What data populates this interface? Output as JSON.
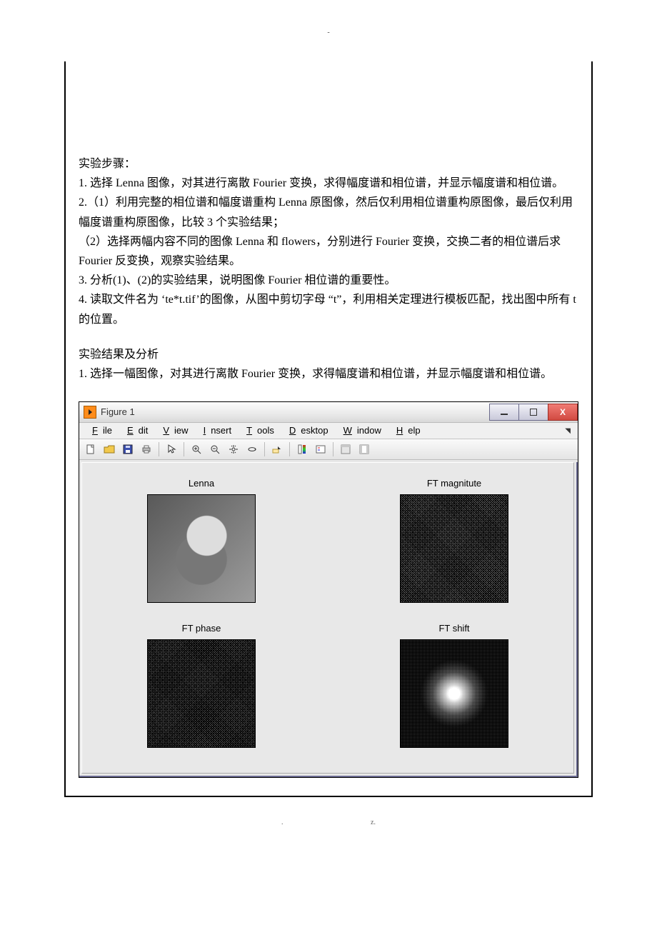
{
  "page_top_mark": "-",
  "footer_left": ".",
  "footer_right": "z.",
  "section_steps_title": "实验步骤：",
  "steps": {
    "s1": "1. 选择 Lenna 图像，对其进行离散 Fourier 变换，求得幅度谱和相位谱，并显示幅度谱和相位谱。",
    "s2a": "2.（1）利用完整的相位谱和幅度谱重构 Lenna 原图像，然后仅利用相位谱重构原图像，最后仅利用幅度谱重构原图像，比较 3 个实验结果；",
    "s2b": "（2）选择两幅内容不同的图像 Lenna 和 flowers，分别进行 Fourier 变换，交换二者的相位谱后求 Fourier 反变换，观察实验结果。",
    "s3": "3. 分析(1)、(2)的实验结果，说明图像 Fourier 相位谱的重要性。",
    "s4": "4. 读取文件名为 ‘te*t.tif’的图像，从图中剪切字母 “t”，利用相关定理进行模板匹配，找出图中所有 t 的位置。"
  },
  "section_results_title": "实验结果及分析",
  "result_1": "1. 选择一幅图像，对其进行离散 Fourier 变换，求得幅度谱和相位谱，并显示幅度谱和相位谱。",
  "figure": {
    "title": "Figure 1",
    "menus": [
      "File",
      "Edit",
      "View",
      "Insert",
      "Tools",
      "Desktop",
      "Window",
      "Help"
    ],
    "menu_underlines": [
      "F",
      "E",
      "V",
      "I",
      "T",
      "D",
      "W",
      "H"
    ],
    "subplots": {
      "tl": "Lenna",
      "tr": "FT magnitute",
      "bl": "FT phase",
      "br": "FT shift"
    }
  }
}
